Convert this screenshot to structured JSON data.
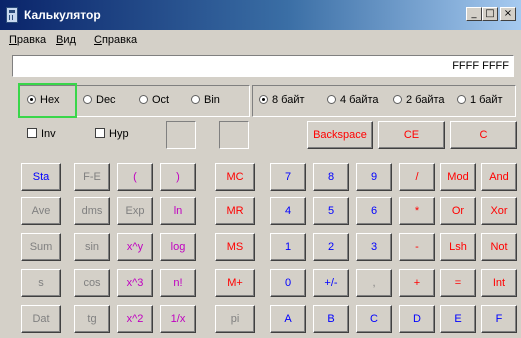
{
  "window": {
    "title": "Калькулятор",
    "min_glyph": "_",
    "max_glyph": "□",
    "close_glyph": "×"
  },
  "menu": {
    "edit": "Правка",
    "view": "Вид",
    "help": "Справка"
  },
  "display": {
    "value": "FFFF FFFF"
  },
  "radix": {
    "hex": "Hex",
    "dec": "Dec",
    "oct": "Oct",
    "bin": "Bin",
    "selected": "Hex"
  },
  "word_size": {
    "b8": "8 байт",
    "b4": "4 байта",
    "b2": "2 байта",
    "b1": "1 байт",
    "selected": "8 байт"
  },
  "checks": {
    "inv": "Inv",
    "hyp": "Hyp"
  },
  "edit_buttons": {
    "backspace": "Backspace",
    "ce": "CE",
    "c": "C"
  },
  "buttons": {
    "sta": "Sta",
    "fe": "F-E",
    "lparen": "(",
    "rparen": ")",
    "mc": "MC",
    "d7": "7",
    "d8": "8",
    "d9": "9",
    "div": "/",
    "mod": "Mod",
    "and": "And",
    "ave": "Ave",
    "dms": "dms",
    "exp": "Exp",
    "ln": "ln",
    "mr": "MR",
    "d4": "4",
    "d5": "5",
    "d6": "6",
    "mul": "*",
    "or": "Or",
    "xor": "Xor",
    "sum": "Sum",
    "sin": "sin",
    "xpowy": "x^y",
    "log": "log",
    "ms": "MS",
    "d1": "1",
    "d2": "2",
    "d3": "3",
    "sub": "-",
    "lsh": "Lsh",
    "not": "Not",
    "s": "s",
    "cos": "cos",
    "xcube": "x^3",
    "nfact": "n!",
    "mplus": "M+",
    "d0": "0",
    "sign": "+/-",
    "dot": ",",
    "add": "+",
    "eq": "=",
    "int": "Int",
    "dat": "Dat",
    "tg": "tg",
    "xsq": "x^2",
    "recip": "1/x",
    "pi": "pi",
    "a": "A",
    "b": "B",
    "c": "C",
    "d": "D",
    "e": "E",
    "f": "F"
  },
  "colors": {
    "blue": "#0000ff",
    "red": "#ff0000",
    "magenta": "#c000c0",
    "disabled": "#808080",
    "highlight": "#39d64a"
  }
}
